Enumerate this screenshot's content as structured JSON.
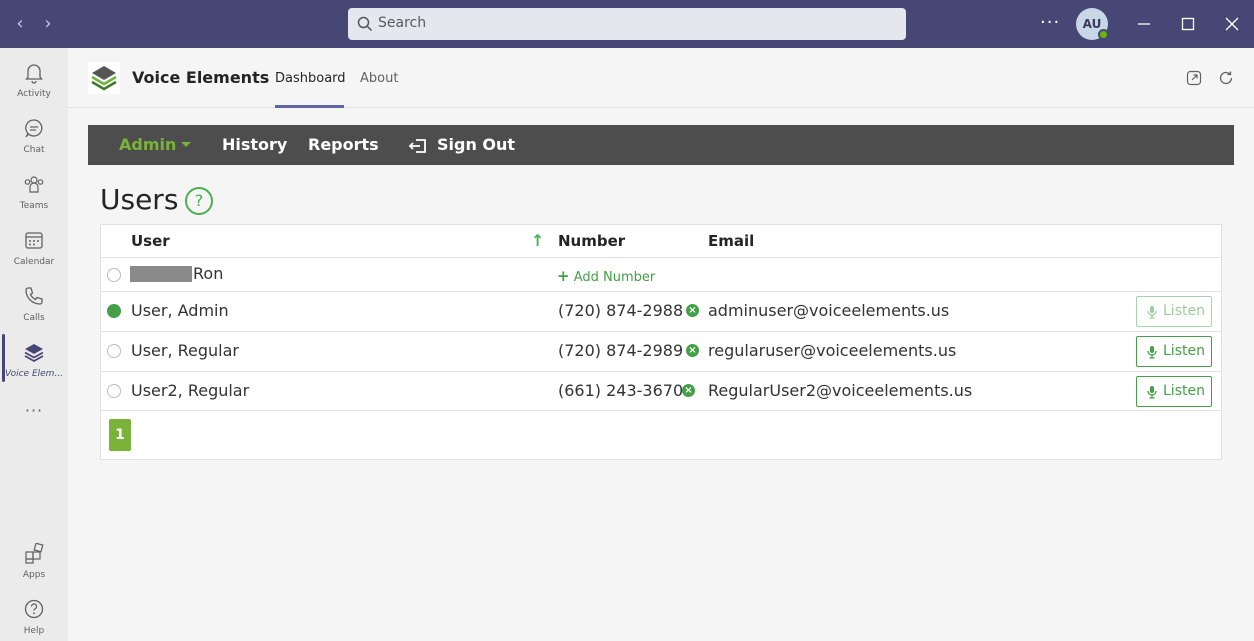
{
  "titlebar": {
    "search_placeholder": "Search",
    "avatar_initials": "AU"
  },
  "rail": {
    "items": [
      {
        "label": "Activity"
      },
      {
        "label": "Chat"
      },
      {
        "label": "Teams"
      },
      {
        "label": "Calendar"
      },
      {
        "label": "Calls"
      },
      {
        "label": "Voice Elem..."
      },
      {
        "label": "Apps"
      },
      {
        "label": "Help"
      }
    ]
  },
  "app": {
    "name": "Voice Elements",
    "tabs": [
      {
        "label": "Dashboard"
      },
      {
        "label": "About"
      }
    ]
  },
  "menu": {
    "admin": "Admin",
    "history": "History",
    "reports": "Reports",
    "signout": "Sign Out"
  },
  "page": {
    "title": "Users",
    "help": "?"
  },
  "table": {
    "headers": {
      "user": "User",
      "number": "Number",
      "email": "Email"
    },
    "add_number_label": "Add Number",
    "listen_label": "Listen",
    "rows": [
      {
        "user": "Ron",
        "number": "",
        "email": "",
        "selected": false
      },
      {
        "user": "User, Admin",
        "number": "(720) 874-2988",
        "email": "adminuser@voiceelements.us",
        "selected": true
      },
      {
        "user": "User, Regular",
        "number": "(720) 874-2989",
        "email": "regularuser@voiceelements.us",
        "selected": false
      },
      {
        "user": "User2, Regular",
        "number": "(661) 243-3670",
        "email": "RegularUser2@voiceelements.us",
        "selected": false
      }
    ],
    "page_number": "1"
  },
  "colors": {
    "titlebar": "#464775",
    "accent_green": "#43a047",
    "menubar": "#4d4d4d"
  }
}
